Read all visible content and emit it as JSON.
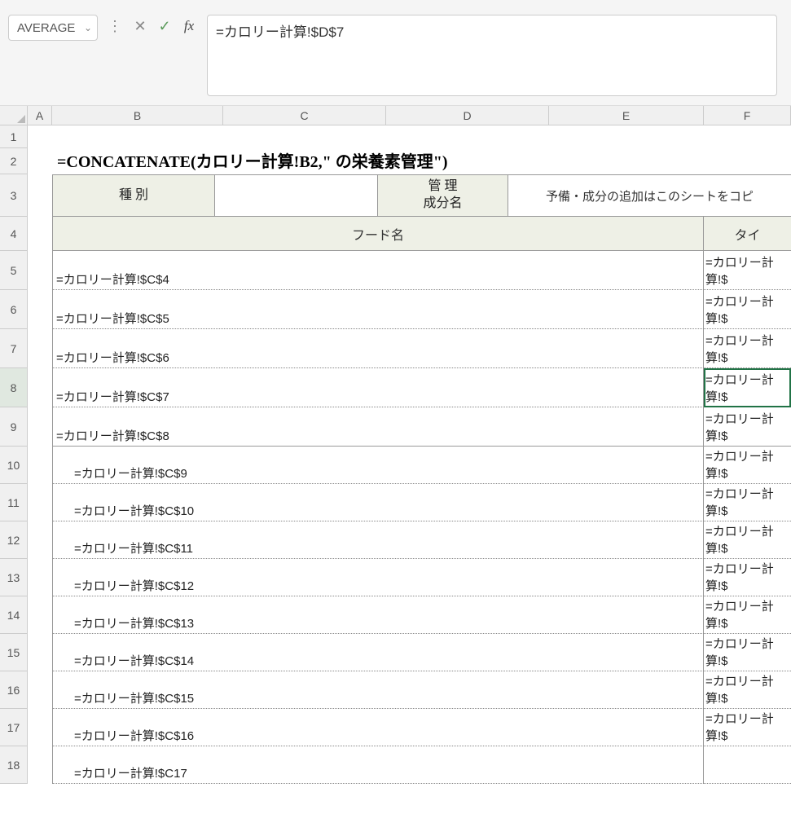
{
  "formula_bar": {
    "name_box": "AVERAGE",
    "formula": "=カロリー計算!$D$7"
  },
  "columns": [
    "A",
    "B",
    "C",
    "D",
    "E",
    "F"
  ],
  "row_headers": [
    "1",
    "2",
    "3",
    "4",
    "5",
    "6",
    "7",
    "8",
    "9",
    "10",
    "11",
    "12",
    "13",
    "14",
    "15",
    "16",
    "17",
    "18"
  ],
  "active_row": 8,
  "title_row": {
    "text": "=CONCATENATE(カロリー計算!B2,\" の栄養素管理\")"
  },
  "header_row1": {
    "shubetsu": "種 別",
    "kanri": "管 理\n成分名",
    "yobi": "予備・成分の追加はこのシートをコピ"
  },
  "header_row2": {
    "food": "フード名",
    "type": "タイ"
  },
  "data_rows": [
    {
      "row": 5,
      "food": "=カロリー計算!$C$4",
      "indent": false,
      "type": "=カロリー計算!$"
    },
    {
      "row": 6,
      "food": "=カロリー計算!$C$5",
      "indent": false,
      "type": "=カロリー計算!$"
    },
    {
      "row": 7,
      "food": "=カロリー計算!$C$6",
      "indent": false,
      "type": "=カロリー計算!$"
    },
    {
      "row": 8,
      "food": "=カロリー計算!$C$7",
      "indent": false,
      "type": "=カロリー計算!$"
    },
    {
      "row": 9,
      "food": "=カロリー計算!$C$8",
      "indent": false,
      "type": "=カロリー計算!$",
      "solid": true
    },
    {
      "row": 10,
      "food": "=カロリー計算!$C$9",
      "indent": true,
      "type": "=カロリー計算!$"
    },
    {
      "row": 11,
      "food": "=カロリー計算!$C$10",
      "indent": true,
      "type": "=カロリー計算!$"
    },
    {
      "row": 12,
      "food": "=カロリー計算!$C$11",
      "indent": true,
      "type": "=カロリー計算!$"
    },
    {
      "row": 13,
      "food": "=カロリー計算!$C$12",
      "indent": true,
      "type": "=カロリー計算!$"
    },
    {
      "row": 14,
      "food": "=カロリー計算!$C$13",
      "indent": true,
      "type": "=カロリー計算!$"
    },
    {
      "row": 15,
      "food": "=カロリー計算!$C$14",
      "indent": true,
      "type": "=カロリー計算!$"
    },
    {
      "row": 16,
      "food": "=カロリー計算!$C$15",
      "indent": true,
      "type": "=カロリー計算!$"
    },
    {
      "row": 17,
      "food": "=カロリー計算!$C$16",
      "indent": true,
      "type": "=カロリー計算!$"
    },
    {
      "row": 18,
      "food": "=カロリー計算!$C17",
      "indent": true,
      "type": ""
    }
  ]
}
